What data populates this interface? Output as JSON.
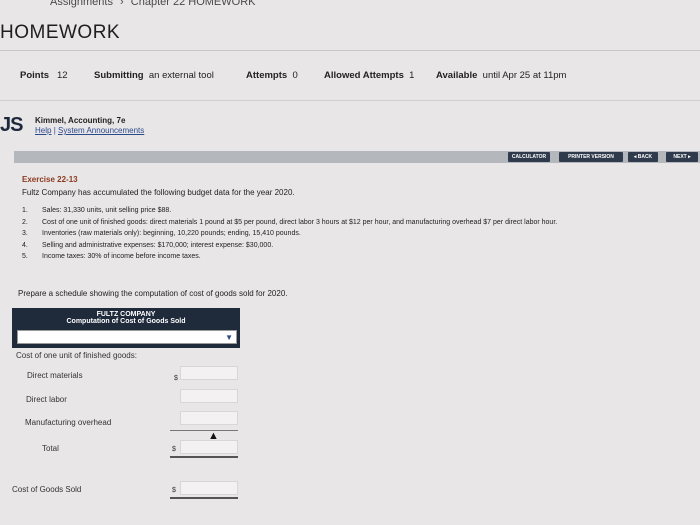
{
  "breadcrumb": {
    "item1": "Assignments",
    "item2": "Chapter 22 HOMEWORK"
  },
  "page_title": "HOMEWORK",
  "meta": {
    "points_label": "Points",
    "points_value": "12",
    "submitting_label": "Submitting",
    "submitting_value": "an external tool",
    "attempts_label": "Attempts",
    "attempts_value": "0",
    "allowed_label": "Allowed Attempts",
    "allowed_value": "1",
    "available_label": "Available",
    "available_value": "until Apr 25 at 11pm"
  },
  "brand": {
    "logo": "JS",
    "title": "Kimmel, Accounting, 7e",
    "help": "Help",
    "sep": "|",
    "announcements": "System Announcements"
  },
  "toolbar": {
    "calculator": "CALCULATOR",
    "printer": "PRINTER VERSION",
    "back": "◂ BACK",
    "next": "NEXT ▸"
  },
  "exercise": {
    "title": "Exercise 22-13",
    "intro": "Fultz Company has accumulated the following budget data for the year 2020.",
    "items": [
      {
        "num": "1.",
        "text": "Sales: 31,330 units, unit selling price $88."
      },
      {
        "num": "2.",
        "text": "Cost of one unit of finished goods: direct materials 1 pound at $5 per pound, direct labor 3 hours at $12 per hour, and manufacturing overhead $7 per direct labor hour."
      },
      {
        "num": "3.",
        "text": "Inventories (raw materials only): beginning, 10,220 pounds; ending, 15,410 pounds."
      },
      {
        "num": "4.",
        "text": "Selling and administrative expenses: $170,000; interest expense: $30,000."
      },
      {
        "num": "5.",
        "text": "Income taxes: 30% of income before income taxes."
      }
    ],
    "prompt": "Prepare a schedule showing the computation of cost of goods sold for 2020."
  },
  "schedule": {
    "company": "FULTZ COMPANY",
    "subtitle": "Computation of Cost of Goods Sold",
    "select_value": "",
    "rows": {
      "unit_cost": "Cost of one unit of finished goods:",
      "direct_materials": "Direct materials",
      "direct_labor": "Direct labor",
      "overhead": "Manufacturing overhead",
      "total": "Total",
      "cogs": "Cost of Goods Sold"
    },
    "currency": "$"
  },
  "colors": {
    "header_bg": "#1f2a3b",
    "toolbar_bg": "#b4b8bd",
    "button_bg": "#2f3b4c",
    "exercise_title": "#8a3a1e",
    "link": "#2a4a8a"
  }
}
